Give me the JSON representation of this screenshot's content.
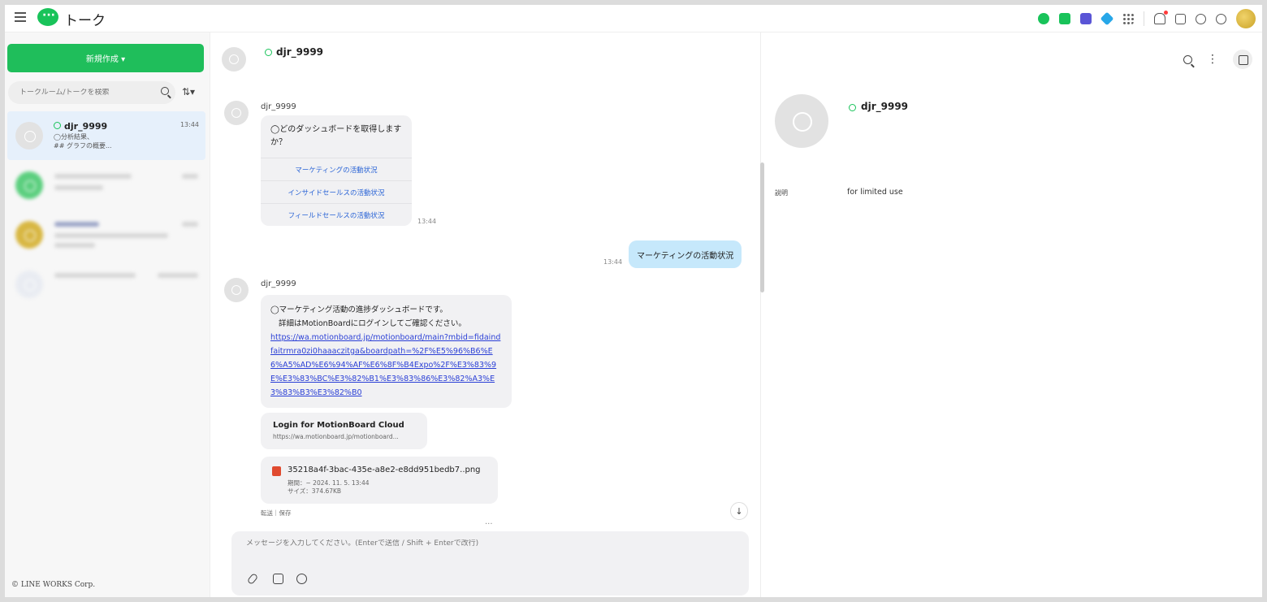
{
  "app": {
    "title": "トーク",
    "brand_color": "#1fbe5b"
  },
  "topbar": {
    "icons": [
      "talk-icon",
      "mail-icon",
      "calendar-icon",
      "drive-icon",
      "apps-grid-icon",
      "bell-icon",
      "org-chart-icon",
      "help-icon",
      "settings-icon"
    ]
  },
  "sidebar": {
    "new_button": "新規作成 ▾",
    "search_placeholder": "トークルーム/トークを検索",
    "sort_label": "⇅▾",
    "rooms": [
      {
        "name": "djr_9999",
        "time": "13:44",
        "preview_line1": "◯分析結果、",
        "preview_line2": "## グラフの概要..."
      }
    ],
    "copyright": "© LINE WORKS Corp."
  },
  "chat": {
    "header_name": "djr_9999",
    "messages": {
      "m1": {
        "sender": "djr_9999",
        "question": "◯どのダッシュボードを取得しますか？",
        "options": [
          "マーケティングの活動状況",
          "インサイドセールスの活動状況",
          "フィールドセールスの活動状況"
        ],
        "time": "13:44"
      },
      "m2": {
        "text": "マーケティングの活動状況",
        "time": "13:44"
      },
      "m3": {
        "sender": "djr_9999",
        "line1": "◯マーケティング活動の進捗ダッシュボードです。",
        "line2": "詳細はMotionBoardにログインしてご確認ください。",
        "link": "https://wa.motionboard.jp/motionboard/main?mbid=fidaindfaitrmra0zi0haaaczitga&boardpath=%2F%E5%96%B6%E6%A5%AD%E6%94%AF%E6%8F%B4Expo%2F%E3%83%9E%E3%83%BC%E3%82%B1%E3%83%86%E3%82%A3%E3%83%B3%E3%82%B0",
        "preview_title": "Login for MotionBoard Cloud",
        "preview_url": "https://wa.motionboard.jp/motionboard...",
        "file_name": "35218a4f-3bac-435e-a8e2-e8dd951bedb7..png",
        "file_period": "期間：~ 2024. 11. 5. 13:44",
        "file_size": "サイズ：374.67KB",
        "file_actions": "転送｜保存"
      }
    },
    "more_dots": "...",
    "composer_placeholder": "メッセージを入力してください。(Enterで送信 / Shift + Enterで改行)"
  },
  "profile": {
    "name": "djr_9999",
    "description_label": "説明",
    "description_value": "for limited use"
  }
}
